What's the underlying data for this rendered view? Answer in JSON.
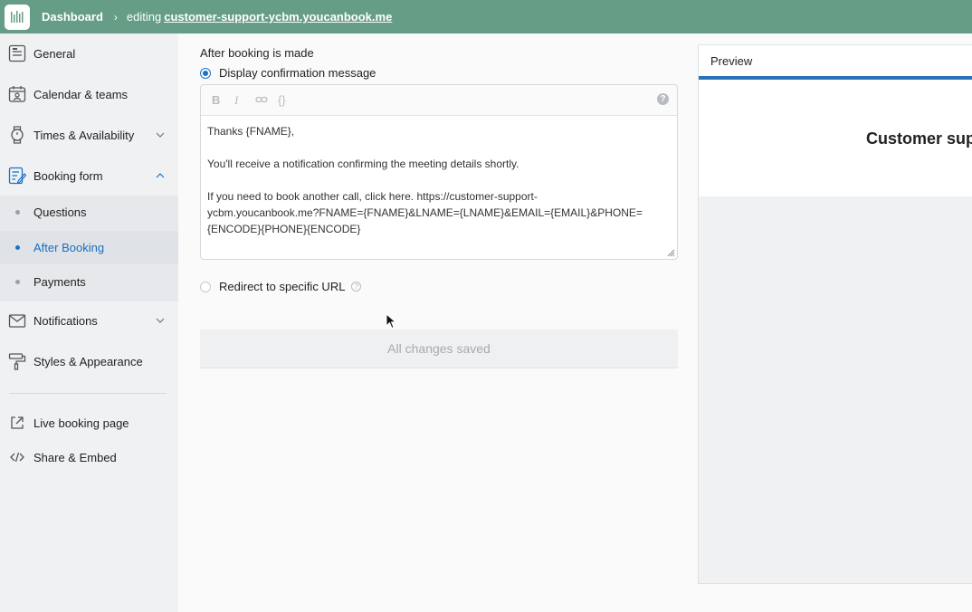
{
  "topbar": {
    "dashboard": "Dashboard",
    "editing": "editing",
    "url": "customer-support-ycbm.youcanbook.me"
  },
  "sidebar": {
    "general": "General",
    "calendar": "Calendar & teams",
    "times": "Times & Availability",
    "booking_form": "Booking form",
    "sub": [
      "Questions",
      "After Booking",
      "Payments"
    ],
    "notifications": "Notifications",
    "styles": "Styles & Appearance",
    "live": "Live booking page",
    "share": "Share & Embed"
  },
  "main": {
    "section_title": "After booking is made",
    "option_message": "Display confirmation message",
    "option_redirect": "Redirect to specific URL",
    "toolbar": {
      "bold": "B",
      "italic": "I",
      "braces": "{}",
      "help": "?"
    },
    "message": "Thanks {FNAME},\n\nYou'll receive a notification confirming the meeting details shortly.\n\nIf you need to book another call, click here. https://customer-support-\nycbm.youcanbook.me?FNAME={FNAME}&LNAME={LNAME}&EMAIL={EMAIL}&PHONE=\n{ENCODE}{PHONE}{ENCODE}",
    "saved": "All changes saved"
  },
  "preview": {
    "label": "Preview",
    "title": "Customer sup"
  },
  "colors": {
    "topbar": "#659d86",
    "accent": "#1a73c6"
  }
}
